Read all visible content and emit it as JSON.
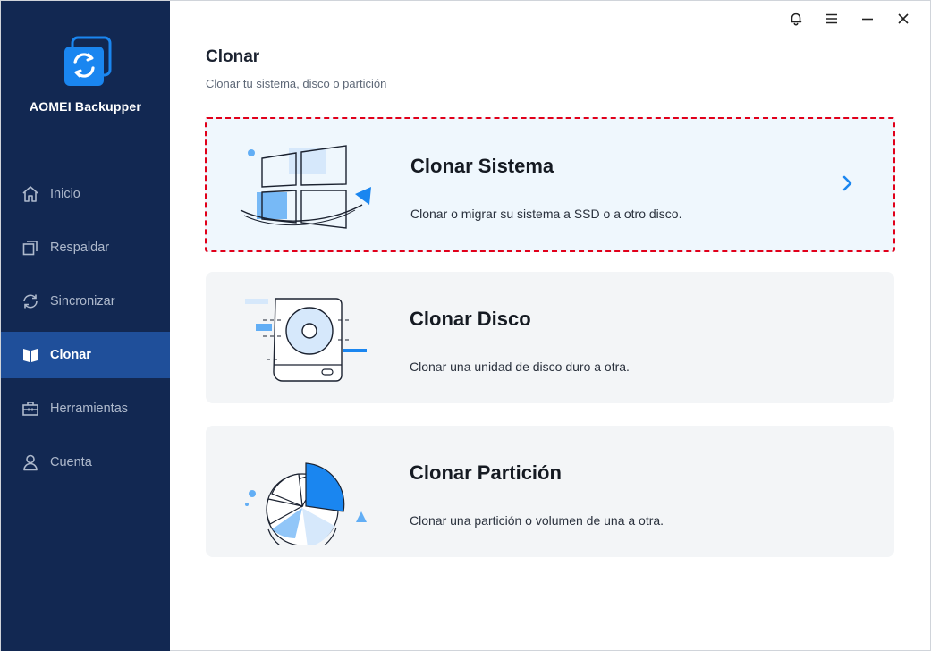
{
  "app": {
    "name": "AOMEI Backupper"
  },
  "sidebar": {
    "items": [
      {
        "label": "Inicio",
        "icon": "home-icon"
      },
      {
        "label": "Respaldar",
        "icon": "backup-icon"
      },
      {
        "label": "Sincronizar",
        "icon": "sync-icon"
      },
      {
        "label": "Clonar",
        "icon": "clone-icon",
        "active": true
      },
      {
        "label": "Herramientas",
        "icon": "toolbox-icon"
      },
      {
        "label": "Cuenta",
        "icon": "user-icon"
      }
    ]
  },
  "window_controls": [
    "bell-icon",
    "menu-icon",
    "minimize-icon",
    "close-icon"
  ],
  "main": {
    "title": "Clonar",
    "subtitle": "Clonar tu sistema, disco o partición",
    "cards": [
      {
        "title": "Clonar Sistema",
        "desc": "Clonar o migrar su sistema a SSD o a otro disco.",
        "selected": true
      },
      {
        "title": "Clonar Disco",
        "desc": "Clonar una unidad de disco duro a otra."
      },
      {
        "title": "Clonar Partición",
        "desc": "Clonar una partición o volumen de una a otra."
      }
    ]
  },
  "colors": {
    "sidebar_bg": "#122852",
    "sidebar_active": "#1f4f9a",
    "accent": "#1a86f0",
    "selection_border": "#e1001a"
  }
}
